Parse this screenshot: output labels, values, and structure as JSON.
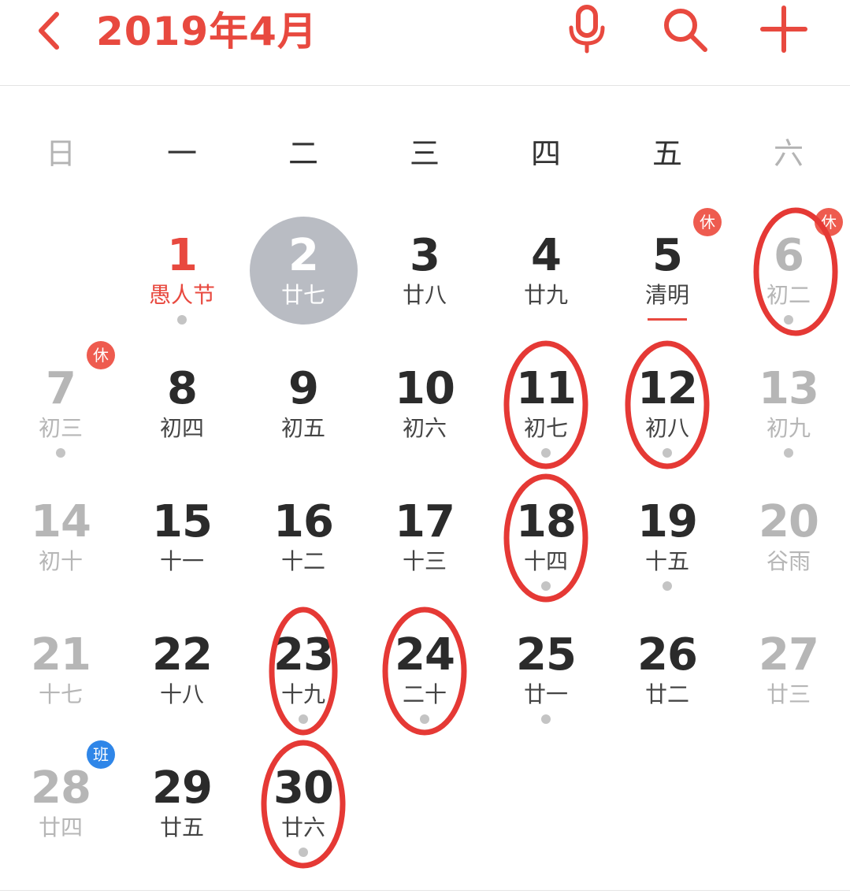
{
  "header": {
    "title": "2019年4月",
    "accent_color": "#e8493f",
    "back_icon": "chevron-left-icon",
    "actions": [
      "microphone-icon",
      "search-icon",
      "plus-icon"
    ]
  },
  "weekdays": [
    "日",
    "一",
    "二",
    "三",
    "四",
    "五",
    "六"
  ],
  "colors": {
    "holiday_text": "#e8493f",
    "rest_badge": "#ee5b4f",
    "work_badge": "#2f86e8",
    "weekend_text": "#b6b6b6",
    "selected_circle": "#b9bcc3",
    "annotation_ring": "#e53935"
  },
  "days": [
    {
      "day": "1",
      "lunar": "愚人节",
      "holiday": true,
      "dot": true
    },
    {
      "day": "2",
      "lunar": "廿七",
      "selected": true
    },
    {
      "day": "3",
      "lunar": "廿八"
    },
    {
      "day": "4",
      "lunar": "廿九"
    },
    {
      "day": "5",
      "lunar": "清明",
      "badge": "休",
      "solar_term": true
    },
    {
      "day": "6",
      "lunar": "初二",
      "badge": "休",
      "dot": true,
      "circled": true
    },
    {
      "day": "7",
      "lunar": "初三",
      "badge": "休",
      "dot": true
    },
    {
      "day": "8",
      "lunar": "初四"
    },
    {
      "day": "9",
      "lunar": "初五"
    },
    {
      "day": "10",
      "lunar": "初六"
    },
    {
      "day": "11",
      "lunar": "初七",
      "dot": true,
      "circled": true
    },
    {
      "day": "12",
      "lunar": "初八",
      "dot": true,
      "circled": true
    },
    {
      "day": "13",
      "lunar": "初九",
      "dot": true
    },
    {
      "day": "14",
      "lunar": "初十"
    },
    {
      "day": "15",
      "lunar": "十一"
    },
    {
      "day": "16",
      "lunar": "十二"
    },
    {
      "day": "17",
      "lunar": "十三"
    },
    {
      "day": "18",
      "lunar": "十四",
      "dot": true,
      "circled": true
    },
    {
      "day": "19",
      "lunar": "十五",
      "dot": true
    },
    {
      "day": "20",
      "lunar": "谷雨"
    },
    {
      "day": "21",
      "lunar": "十七"
    },
    {
      "day": "22",
      "lunar": "十八"
    },
    {
      "day": "23",
      "lunar": "十九",
      "dot": true,
      "circled": true
    },
    {
      "day": "24",
      "lunar": "二十",
      "dot": true,
      "circled": true
    },
    {
      "day": "25",
      "lunar": "廿一",
      "dot": true
    },
    {
      "day": "26",
      "lunar": "廿二"
    },
    {
      "day": "27",
      "lunar": "廿三"
    },
    {
      "day": "28",
      "lunar": "廿四",
      "badge": "班"
    },
    {
      "day": "29",
      "lunar": "廿五"
    },
    {
      "day": "30",
      "lunar": "廿六",
      "dot": true,
      "circled": true
    }
  ]
}
